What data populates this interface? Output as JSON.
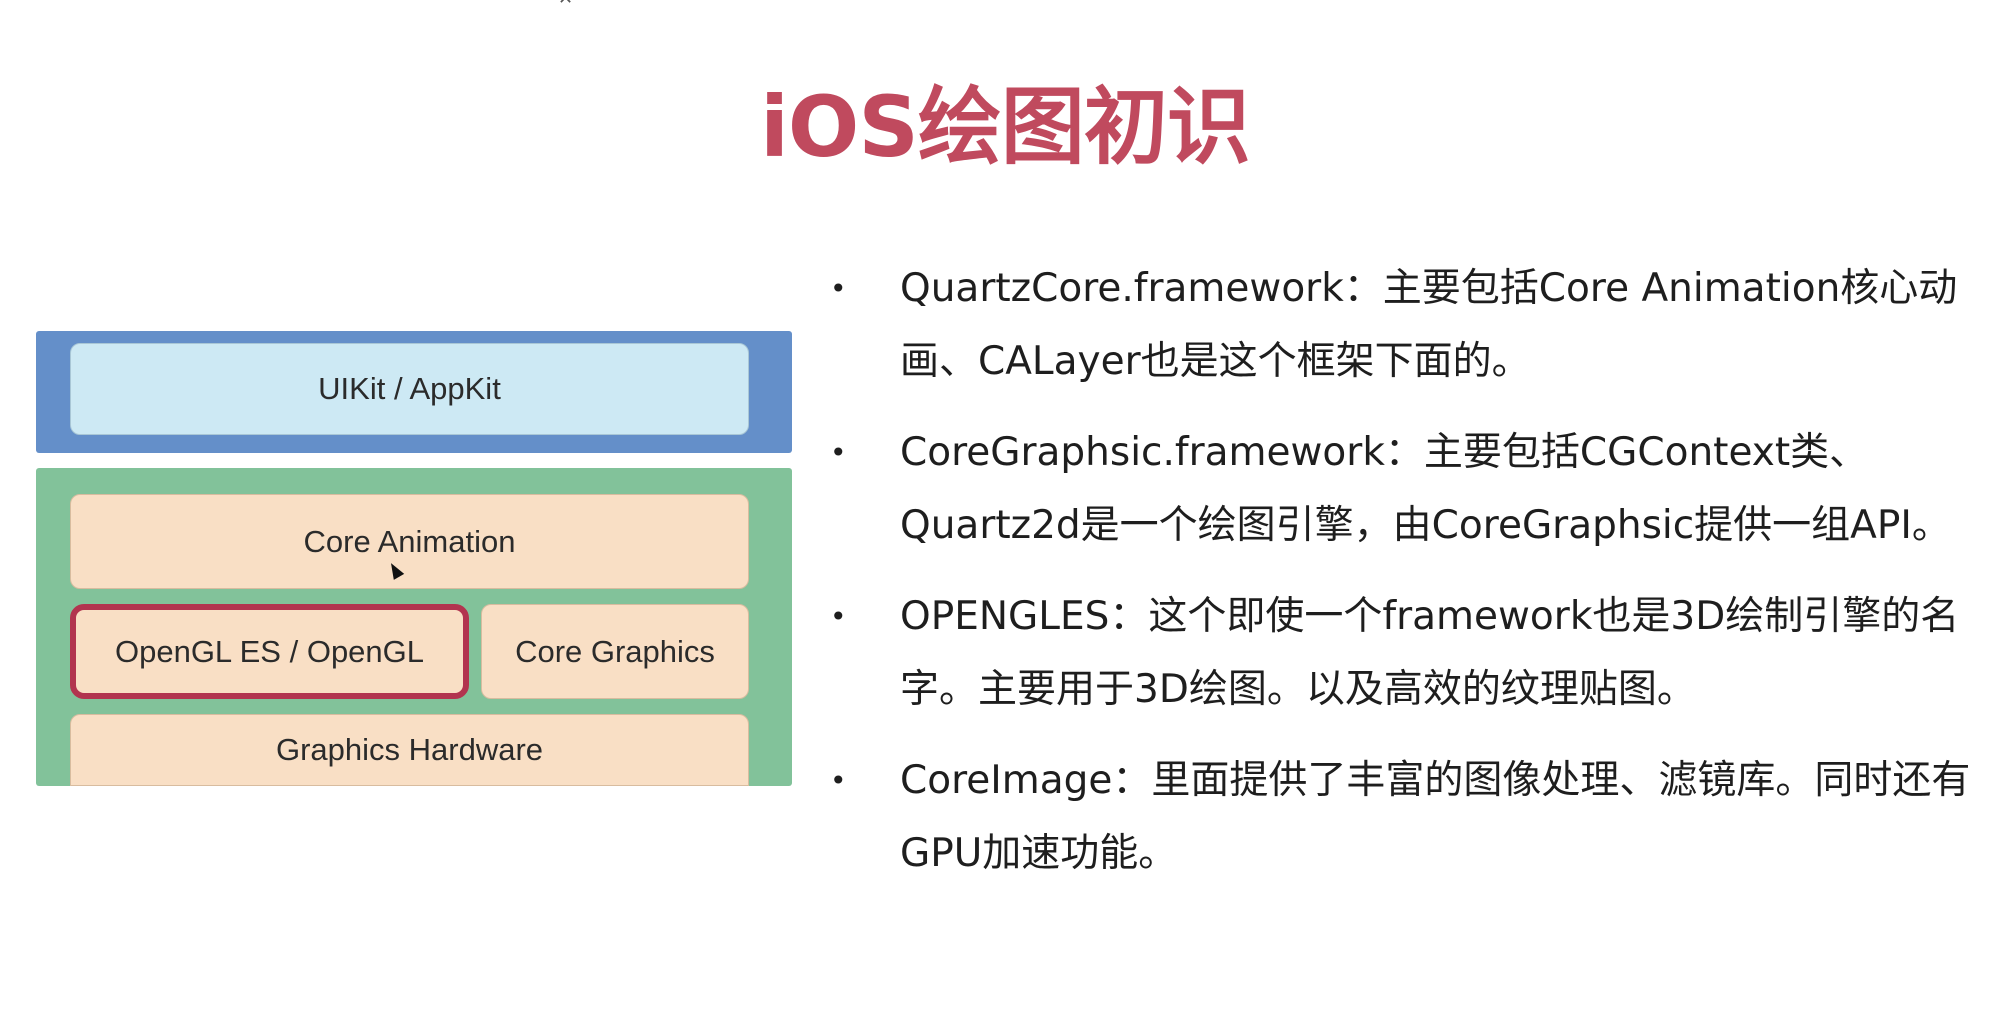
{
  "title": "iOS绘图初识",
  "diagram": {
    "top_layer": {
      "uikit_label": "UIKit / AppKit",
      "color": "#648fc9",
      "box_color": "#cde9f4"
    },
    "bottom_layer": {
      "color": "#82c29a",
      "box_color": "#f9dfc5",
      "core_animation_label": "Core Animation",
      "opengl_label": "OpenGL ES / OpenGL",
      "core_graphics_label": "Core Graphics",
      "graphics_hardware_label": "Graphics Hardware",
      "highlight_color": "#b2344f"
    }
  },
  "bullets": [
    {
      "bullet": "•",
      "text": "QuartzCore.framework：主要包括Core Animation核心动画、CALayer也是这个框架下面的。"
    },
    {
      "bullet": "•",
      "text": "CoreGraphsic.framework：主要包括CGContext类、Quartz2d是一个绘图引擎，由CoreGraphsic提供一组API。"
    },
    {
      "bullet": "•",
      "text": "OPENGLES：这个即使一个framework也是3D绘制引擎的名字。主要用于3D绘图。以及高效的纹理贴图。"
    },
    {
      "bullet": "•",
      "text": "CoreImage：里面提供了丰富的图像处理、滤镜库。同时还有GPU加速功能。"
    }
  ],
  "colors": {
    "title": "#c04a5e",
    "text": "#1e1e1e"
  }
}
